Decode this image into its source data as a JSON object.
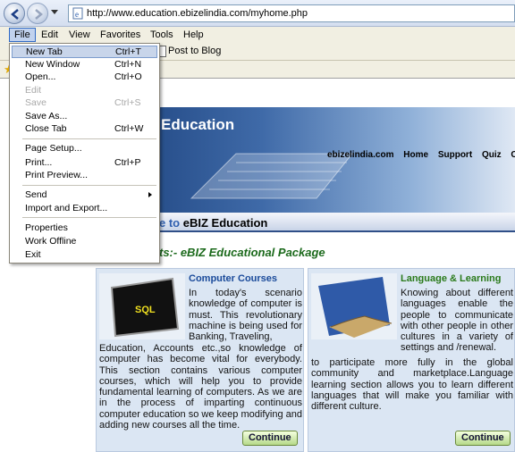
{
  "address": {
    "url": "http://www.education.ebizelindia.com/myhome.php"
  },
  "menubar": {
    "file": "File",
    "edit": "Edit",
    "view": "View",
    "favorites": "Favorites",
    "tools": "Tools",
    "help": "Help"
  },
  "toolbar": {
    "post_to_blog": "Post to Blog"
  },
  "file_menu": {
    "new_tab": "New Tab",
    "new_tab_sc": "Ctrl+T",
    "new_window": "New Window",
    "new_window_sc": "Ctrl+N",
    "open": "Open...",
    "open_sc": "Ctrl+O",
    "edit": "Edit",
    "save": "Save",
    "save_sc": "Ctrl+S",
    "save_as": "Save As...",
    "close_tab": "Close Tab",
    "close_tab_sc": "Ctrl+W",
    "page_setup": "Page Setup...",
    "print": "Print...",
    "print_sc": "Ctrl+P",
    "print_preview": "Print Preview...",
    "send": "Send",
    "import_export": "Import and Export...",
    "properties": "Properties",
    "work_offline": "Work Offline",
    "exit": "Exit"
  },
  "site": {
    "banner_title": "Education",
    "nav": {
      "domain": "ebizelindia.com",
      "home": "Home",
      "support": "Support",
      "quiz": "Quiz",
      "more": "C"
    },
    "welcome_prefix": "e to",
    "welcome_brand": "eBIZ Education",
    "package_title": "ts:- eBIZ Educational Package",
    "cards": {
      "computer": {
        "image_label": "SQL",
        "title": "Computer Courses",
        "body_top": "In today's scenario knowledge of computer is must. This revolutionary machine is being used for Banking, Traveling,",
        "body_bottom": "Education, Accounts etc.,so knowledge of computer has become vital for everybody. This section contains various computer courses, which will help you to provide fundamental learning of computers. As we are in the process of imparting continuous computer education so we keep modifying and adding new courses all the time.",
        "button": "Continue"
      },
      "language": {
        "title": "Language & Learning",
        "body_top": "Knowing about different languages enable the people to communicate with other people in other cultures in a variety of settings and /renewal.",
        "body_bottom": "to participate more fully in the global community and marketplace.Language learning section allows you to learn different languages that will make you familiar with different culture.",
        "button": "Continue"
      }
    }
  },
  "colors": {
    "menu_highlight": "#c1d2ee",
    "package_title": "#1c6a1c",
    "card_title_computer": "#1a4a9a",
    "card_title_language": "#2a7a1a"
  }
}
